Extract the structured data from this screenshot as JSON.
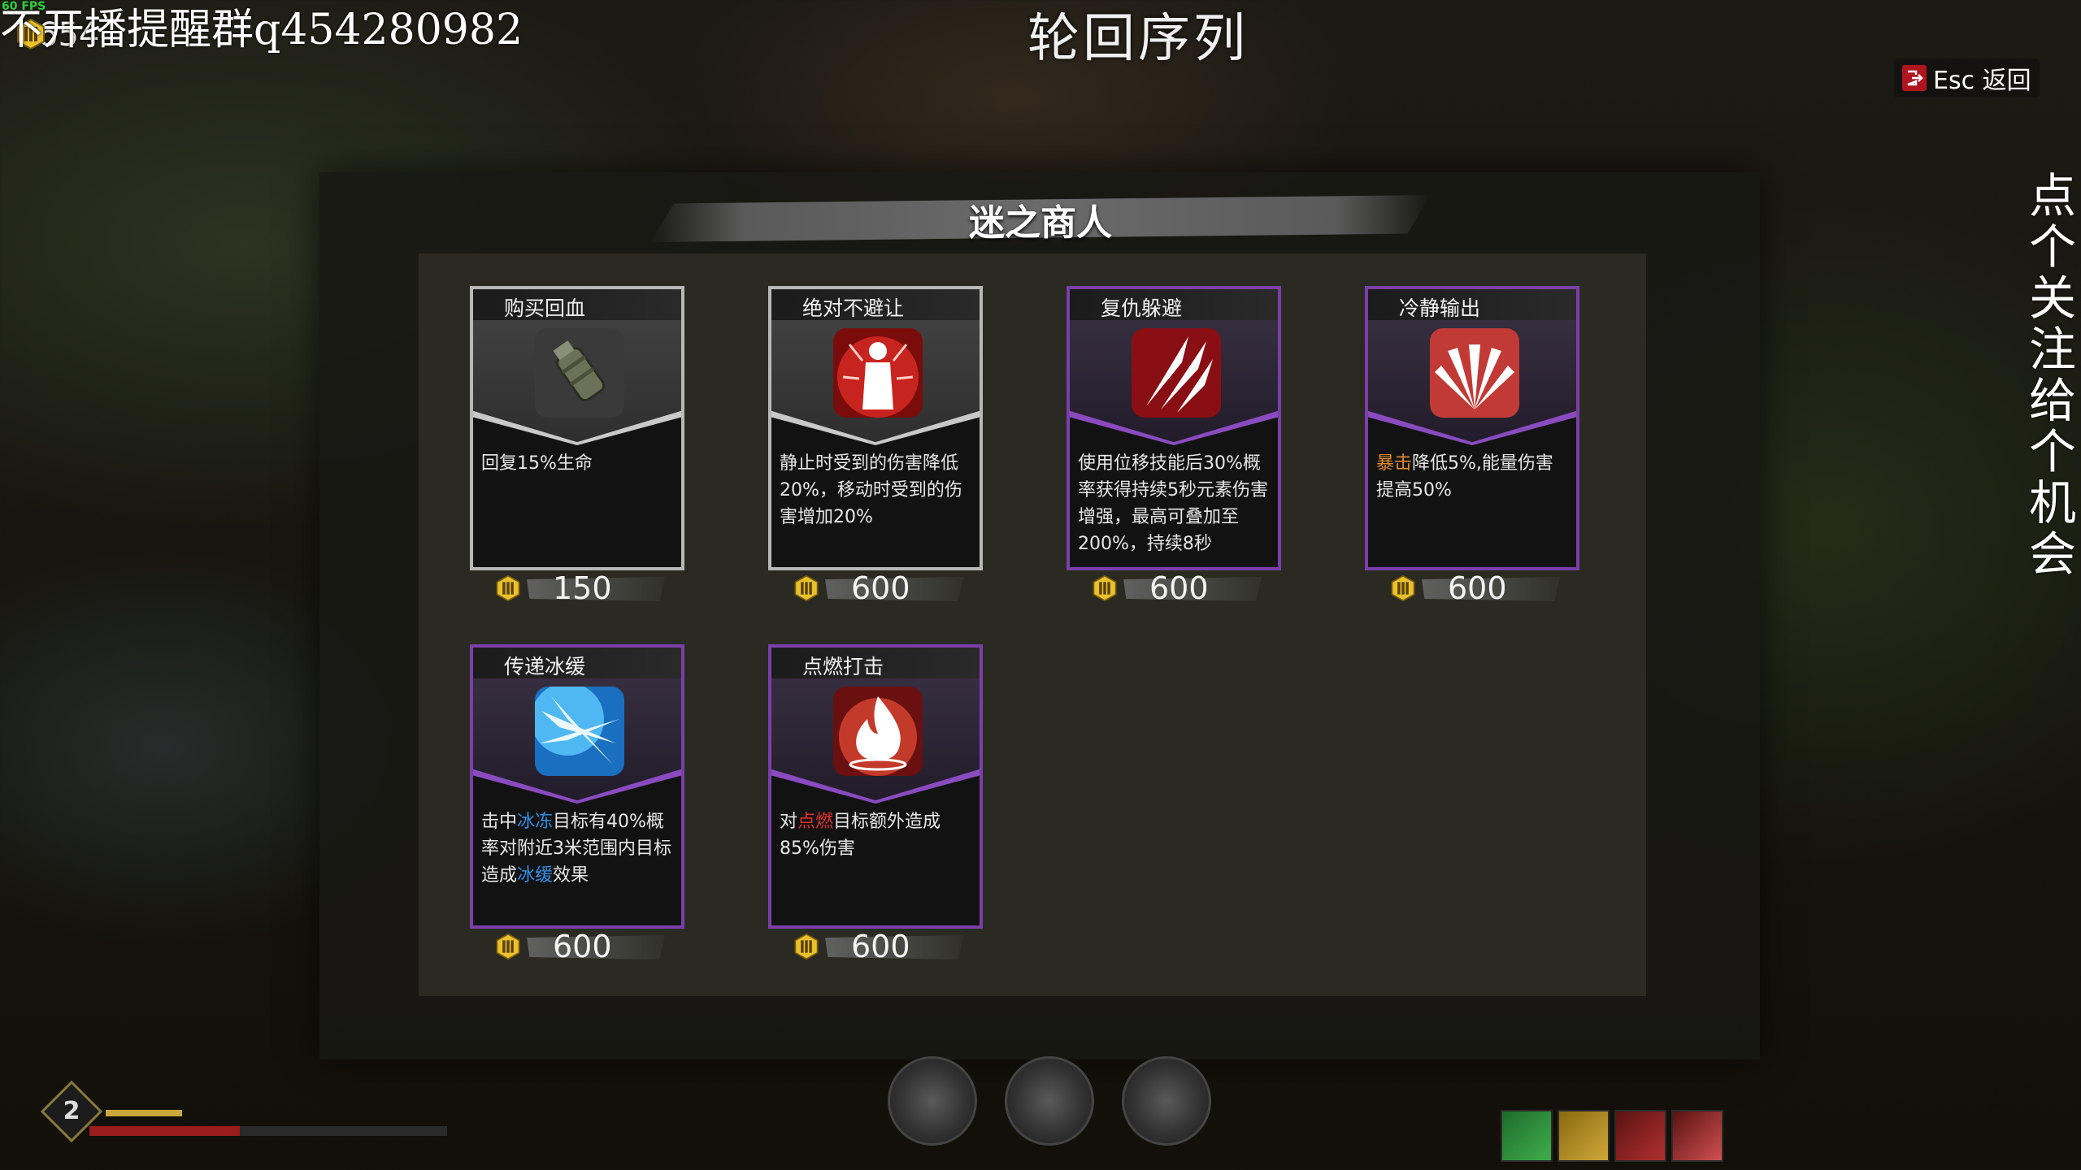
{
  "hud": {
    "fps": "60 FPS",
    "currency": "654",
    "overlay_text": "不开播提醒群q454280982",
    "screen_title": "轮回序列",
    "esc_label": "Esc 返回",
    "vertical_text": "点个关注，给个机会",
    "level": "2",
    "hp_fraction": 0.42
  },
  "shop": {
    "title": "迷之商人",
    "items": [
      {
        "name": "购买回血",
        "desc": [
          {
            "t": "回复15%生命"
          }
        ],
        "price": "150",
        "rarity": "grey",
        "icon": "grenade-icon"
      },
      {
        "name": "绝对不避让",
        "desc": [
          {
            "t": "静止时受到的伤害降低20%，移动时受到的伤害增加20%"
          }
        ],
        "price": "600",
        "rarity": "grey",
        "icon": "aura-figure-icon"
      },
      {
        "name": "复仇躲避",
        "desc": [
          {
            "t": "使用位移技能后30%概率获得持续5秒元素伤害增强，最高可叠加至200%，持续8秒"
          }
        ],
        "price": "600",
        "rarity": "purple",
        "icon": "claw-slash-icon"
      },
      {
        "name": "冷静输出",
        "desc": [
          {
            "t": "暴击",
            "c": "orange"
          },
          {
            "t": "降低5%,能量伤害提高50%"
          }
        ],
        "price": "600",
        "rarity": "purple",
        "icon": "burst-icon"
      },
      {
        "name": "传递冰缓",
        "desc": [
          {
            "t": "击中"
          },
          {
            "t": "冰冻",
            "c": "blue"
          },
          {
            "t": "目标有40%概率对附近3米范围内目标造成"
          },
          {
            "t": "冰缓",
            "c": "blue"
          },
          {
            "t": "效果"
          }
        ],
        "price": "600",
        "rarity": "purple",
        "icon": "ice-shard-icon"
      },
      {
        "name": "点燃打击",
        "desc": [
          {
            "t": "对"
          },
          {
            "t": "点燃",
            "c": "red"
          },
          {
            "t": "目标额外造成85%伤害"
          }
        ],
        "price": "600",
        "rarity": "purple",
        "icon": "flame-icon"
      }
    ]
  },
  "colors": {
    "grey_border": "#b8b8b8",
    "purple_border": "#7a3fa8",
    "accent_red": "#b0151f",
    "coin_gold": "#e9c12c"
  }
}
